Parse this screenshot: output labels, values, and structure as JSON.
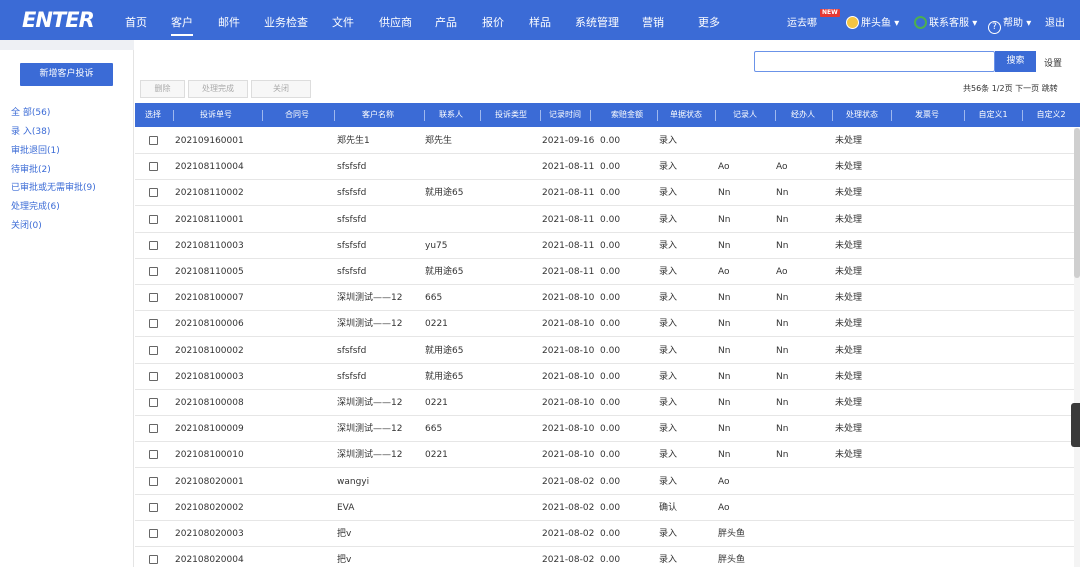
{
  "logo": "ENTER",
  "nav": {
    "items": [
      "首页",
      "客户",
      "邮件",
      "业务检查",
      "文件",
      "供应商",
      "产品",
      "报价",
      "样品",
      "系统管理",
      "营销",
      "更多"
    ],
    "active": "客户",
    "yunqu": "运去哪",
    "new_badge": "NEW",
    "user": "胖头鱼",
    "service": "联系客服",
    "help": "帮助",
    "logout": "退出"
  },
  "sidebar": {
    "new_button": "新增客户投诉",
    "items": [
      "全 部(56)",
      "录 入(38)",
      "审批退回(1)",
      "待审批(2)",
      "已审批或无需审批(9)",
      "处理完成(6)",
      "关闭(0)"
    ]
  },
  "toolbar": {
    "delete": "删除",
    "complete": "处理完成",
    "close": "关闭",
    "search_value": "",
    "search_button": "搜索",
    "settings": "设置"
  },
  "pager": {
    "summary": "共56条 1/2页",
    "next": "下一页",
    "jump": "跳转"
  },
  "table": {
    "headers": [
      "选择",
      "投诉单号",
      "合同号",
      "客户名称",
      "联系人",
      "投诉类型",
      "记录时间",
      "索赔金额",
      "单据状态",
      "记录人",
      "经办人",
      "处理状态",
      "发票号",
      "自定义1",
      "自定义2"
    ],
    "rows": [
      {
        "no": "202109160001",
        "contract": "",
        "customer": "郑先生1",
        "contact": "郑先生",
        "type": "",
        "time": "2021-09-16",
        "amount": "0.00",
        "status": "录入",
        "recorder": "",
        "handler": "",
        "process": "未处理",
        "invoice": "",
        "c1": "",
        "c2": ""
      },
      {
        "no": "202108110004",
        "contract": "",
        "customer": "sfsfsfd",
        "contact": "",
        "type": "",
        "time": "2021-08-11",
        "amount": "0.00",
        "status": "录入",
        "recorder": "Ao",
        "handler": "Ao",
        "process": "未处理",
        "invoice": "",
        "c1": "",
        "c2": ""
      },
      {
        "no": "202108110002",
        "contract": "",
        "customer": "sfsfsfd",
        "contact": "就用途65",
        "type": "",
        "time": "2021-08-11",
        "amount": "0.00",
        "status": "录入",
        "recorder": "Nn",
        "handler": "Nn",
        "process": "未处理",
        "invoice": "",
        "c1": "",
        "c2": ""
      },
      {
        "no": "202108110001",
        "contract": "",
        "customer": "sfsfsfd",
        "contact": "",
        "type": "",
        "time": "2021-08-11",
        "amount": "0.00",
        "status": "录入",
        "recorder": "Nn",
        "handler": "Nn",
        "process": "未处理",
        "invoice": "",
        "c1": "",
        "c2": ""
      },
      {
        "no": "202108110003",
        "contract": "",
        "customer": "sfsfsfd",
        "contact": "yu75",
        "type": "",
        "time": "2021-08-11",
        "amount": "0.00",
        "status": "录入",
        "recorder": "Nn",
        "handler": "Nn",
        "process": "未处理",
        "invoice": "",
        "c1": "",
        "c2": ""
      },
      {
        "no": "202108110005",
        "contract": "",
        "customer": "sfsfsfd",
        "contact": "就用途65",
        "type": "",
        "time": "2021-08-11",
        "amount": "0.00",
        "status": "录入",
        "recorder": "Ao",
        "handler": "Ao",
        "process": "未处理",
        "invoice": "",
        "c1": "",
        "c2": ""
      },
      {
        "no": "202108100007",
        "contract": "",
        "customer": "深圳测试——12",
        "contact": "665",
        "type": "",
        "time": "2021-08-10",
        "amount": "0.00",
        "status": "录入",
        "recorder": "Nn",
        "handler": "Nn",
        "process": "未处理",
        "invoice": "",
        "c1": "",
        "c2": ""
      },
      {
        "no": "202108100006",
        "contract": "",
        "customer": "深圳测试——12",
        "contact": "0221",
        "type": "",
        "time": "2021-08-10",
        "amount": "0.00",
        "status": "录入",
        "recorder": "Nn",
        "handler": "Nn",
        "process": "未处理",
        "invoice": "",
        "c1": "",
        "c2": ""
      },
      {
        "no": "202108100002",
        "contract": "",
        "customer": "sfsfsfd",
        "contact": "就用途65",
        "type": "",
        "time": "2021-08-10",
        "amount": "0.00",
        "status": "录入",
        "recorder": "Nn",
        "handler": "Nn",
        "process": "未处理",
        "invoice": "",
        "c1": "",
        "c2": ""
      },
      {
        "no": "202108100003",
        "contract": "",
        "customer": "sfsfsfd",
        "contact": "就用途65",
        "type": "",
        "time": "2021-08-10",
        "amount": "0.00",
        "status": "录入",
        "recorder": "Nn",
        "handler": "Nn",
        "process": "未处理",
        "invoice": "",
        "c1": "",
        "c2": ""
      },
      {
        "no": "202108100008",
        "contract": "",
        "customer": "深圳测试——12",
        "contact": "0221",
        "type": "",
        "time": "2021-08-10",
        "amount": "0.00",
        "status": "录入",
        "recorder": "Nn",
        "handler": "Nn",
        "process": "未处理",
        "invoice": "",
        "c1": "",
        "c2": ""
      },
      {
        "no": "202108100009",
        "contract": "",
        "customer": "深圳测试——12",
        "contact": "665",
        "type": "",
        "time": "2021-08-10",
        "amount": "0.00",
        "status": "录入",
        "recorder": "Nn",
        "handler": "Nn",
        "process": "未处理",
        "invoice": "",
        "c1": "",
        "c2": ""
      },
      {
        "no": "202108100010",
        "contract": "",
        "customer": "深圳测试——12",
        "contact": "0221",
        "type": "",
        "time": "2021-08-10",
        "amount": "0.00",
        "status": "录入",
        "recorder": "Nn",
        "handler": "Nn",
        "process": "未处理",
        "invoice": "",
        "c1": "",
        "c2": ""
      },
      {
        "no": "202108020001",
        "contract": "",
        "customer": "wangyi",
        "contact": "",
        "type": "",
        "time": "2021-08-02",
        "amount": "0.00",
        "status": "录入",
        "recorder": "Ao",
        "handler": "",
        "process": "",
        "invoice": "",
        "c1": "",
        "c2": ""
      },
      {
        "no": "202108020002",
        "contract": "",
        "customer": "EVA",
        "contact": "",
        "type": "",
        "time": "2021-08-02",
        "amount": "0.00",
        "status": "确认",
        "recorder": "Ao",
        "handler": "",
        "process": "",
        "invoice": "",
        "c1": "",
        "c2": ""
      },
      {
        "no": "202108020003",
        "contract": "",
        "customer": "把v",
        "contact": "",
        "type": "",
        "time": "2021-08-02",
        "amount": "0.00",
        "status": "录入",
        "recorder": "胖头鱼",
        "handler": "",
        "process": "",
        "invoice": "",
        "c1": "",
        "c2": ""
      },
      {
        "no": "202108020004",
        "contract": "",
        "customer": "把v",
        "contact": "",
        "type": "",
        "time": "2021-08-02",
        "amount": "0.00",
        "status": "录入",
        "recorder": "胖头鱼",
        "handler": "",
        "process": "",
        "invoice": "",
        "c1": "",
        "c2": ""
      }
    ]
  },
  "colors": {
    "brand": "#3b6bd6",
    "header_bg": "#3b6bd6",
    "row_border": "#e6e6e6"
  }
}
